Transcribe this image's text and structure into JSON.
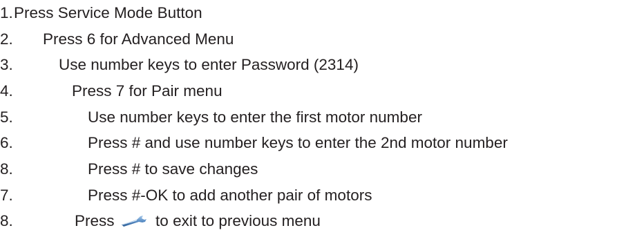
{
  "steps": [
    {
      "number": "1.",
      "text": "Press Service Mode Button"
    },
    {
      "number": "2.",
      "text": "Press 6 for Advanced Menu"
    },
    {
      "number": "3.",
      "text": "Use number keys to enter Password (2314)"
    },
    {
      "number": "4.",
      "text": "Press 7 for Pair menu"
    },
    {
      "number": "5.",
      "text": "Use number keys to enter the first motor number"
    },
    {
      "number": "6.",
      "text": "Press # and use number keys to enter the 2nd motor number"
    },
    {
      "number": "8.",
      "text": "Press # to save changes"
    },
    {
      "number": "7.",
      "text": "Press #-OK to add another pair of motors"
    },
    {
      "number": "8.",
      "text_before": "Press",
      "icon": "wrench-icon",
      "text_after": "to exit to previous menu"
    }
  ],
  "colors": {
    "text": "#231f20",
    "icon": "#5b8fc7"
  }
}
